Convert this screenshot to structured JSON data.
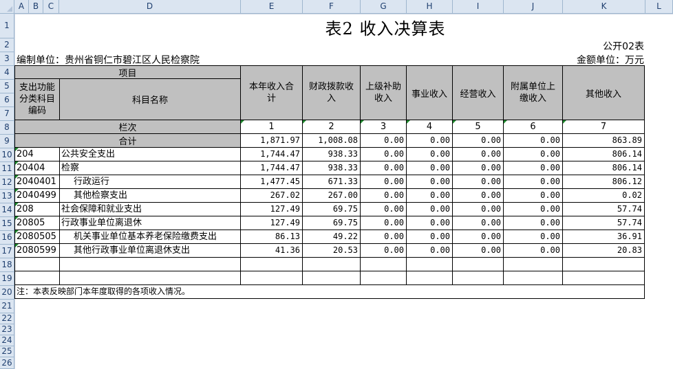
{
  "columns": [
    "A",
    "B",
    "C",
    "D",
    "E",
    "F",
    "G",
    "H",
    "I",
    "J",
    "K",
    "L"
  ],
  "rows": [
    "1",
    "2",
    "3",
    "4",
    "5",
    "6",
    "7",
    "8",
    "9",
    "10",
    "11",
    "12",
    "13",
    "14",
    "15",
    "16",
    "17",
    "18",
    "19",
    "20",
    "21",
    "22",
    "23",
    "24",
    "25",
    "26"
  ],
  "title": "表2  收入决算表",
  "public_no": "公开02表",
  "unit_label": "编制单位：贵州省铜仁市碧江区人民检察院",
  "amount_unit": "金额单位：万元",
  "header": {
    "item": "项目",
    "func_code": "支出功能分类科目编码",
    "subject": "科目名称",
    "total": "本年收入合计",
    "fiscal": "财政拨款收入",
    "superior": "上级补助收入",
    "business": "事业收入",
    "operating": "经营收入",
    "affiliated": "附属单位上缴收入",
    "other": "其他收入",
    "seq": "栏次",
    "n1": "1",
    "n2": "2",
    "n3": "3",
    "n4": "4",
    "n5": "5",
    "n6": "6",
    "n7": "7",
    "sum": "合计"
  },
  "sum_row": [
    "1,871.97",
    "1,008.08",
    "0.00",
    "0.00",
    "0.00",
    "0.00",
    "863.89"
  ],
  "body_rows": [
    {
      "code": "204",
      "name": "公共安全支出",
      "indent": false,
      "v": [
        "1,744.47",
        "938.33",
        "0.00",
        "0.00",
        "0.00",
        "0.00",
        "806.14"
      ]
    },
    {
      "code": "20404",
      "name": "检察",
      "indent": false,
      "v": [
        "1,744.47",
        "938.33",
        "0.00",
        "0.00",
        "0.00",
        "0.00",
        "806.14"
      ]
    },
    {
      "code": "2040401",
      "name": "行政运行",
      "indent": true,
      "v": [
        "1,477.45",
        "671.33",
        "0.00",
        "0.00",
        "0.00",
        "0.00",
        "806.12"
      ]
    },
    {
      "code": "2040499",
      "name": "其他检察支出",
      "indent": true,
      "v": [
        "267.02",
        "267.00",
        "0.00",
        "0.00",
        "0.00",
        "0.00",
        "0.02"
      ]
    },
    {
      "code": "208",
      "name": "社会保障和就业支出",
      "indent": false,
      "v": [
        "127.49",
        "69.75",
        "0.00",
        "0.00",
        "0.00",
        "0.00",
        "57.74"
      ]
    },
    {
      "code": "20805",
      "name": "行政事业单位离退休",
      "indent": false,
      "v": [
        "127.49",
        "69.75",
        "0.00",
        "0.00",
        "0.00",
        "0.00",
        "57.74"
      ]
    },
    {
      "code": "2080505",
      "name": "机关事业单位基本养老保险缴费支出",
      "indent": true,
      "v": [
        "86.13",
        "49.22",
        "0.00",
        "0.00",
        "0.00",
        "0.00",
        "36.91"
      ]
    },
    {
      "code": "2080599",
      "name": "其他行政事业单位离退休支出",
      "indent": true,
      "v": [
        "41.36",
        "20.53",
        "0.00",
        "0.00",
        "0.00",
        "0.00",
        "20.83"
      ]
    }
  ],
  "note": "注：本表反映部门本年度取得的各项收入情况。"
}
